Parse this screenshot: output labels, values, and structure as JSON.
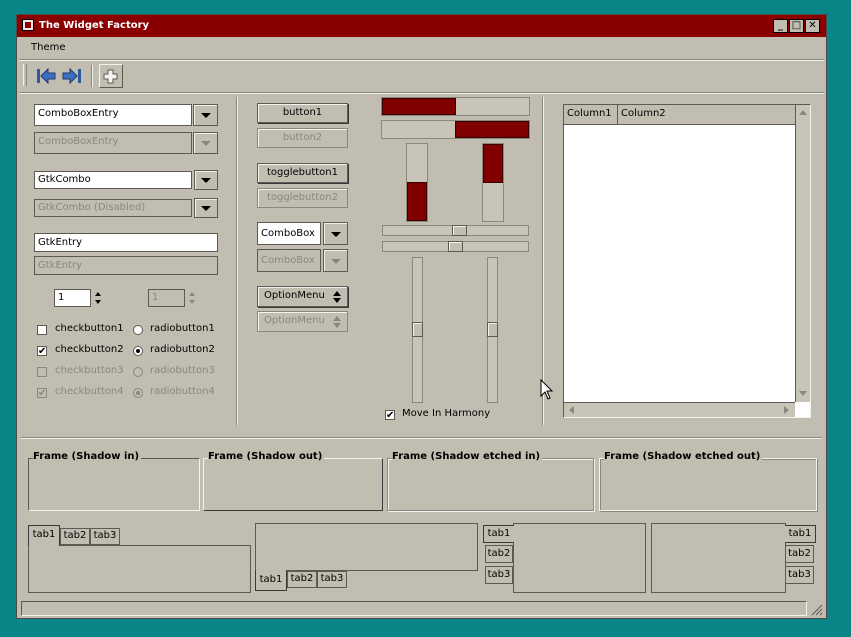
{
  "window": {
    "title": "The Widget Factory",
    "buttons": {
      "minimize": "_",
      "maximize": "□",
      "close": "✕"
    }
  },
  "menu": {
    "theme": "Theme"
  },
  "toolbar": {
    "items": [
      "back-icon",
      "forward-icon",
      "insert-icon"
    ]
  },
  "left": {
    "combo_entry": "ComboBoxEntry",
    "combo_entry_disabled": "ComboBoxEntry",
    "gtk_combo": "GtkCombo",
    "gtk_combo_disabled": "GtkCombo (Disabled)",
    "entry": "GtkEntry",
    "entry_disabled": "GtkEntry",
    "spin": "1",
    "spin_disabled": "1",
    "check1": "checkbutton1",
    "check2": "checkbutton2",
    "check3": "checkbutton3",
    "check4": "checkbutton4",
    "radio1": "radiobutton1",
    "radio2": "radiobutton2",
    "radio3": "radiobutton3",
    "radio4": "radiobutton4",
    "check_mark": "✔"
  },
  "middle": {
    "button1": "button1",
    "button2": "button2",
    "toggle1": "togglebutton1",
    "toggle2": "togglebutton2",
    "combobox": "ComboBox",
    "combobox_disabled": "ComboBox",
    "option_menu": "OptionMenu",
    "option_menu_disabled": "OptionMenu"
  },
  "sliders": {
    "progress_h1": 0.5,
    "progress_h2": 0.5,
    "progress_v1": 0.5,
    "progress_v2": 0.5,
    "harmony_label": "Move In Harmony",
    "harmony_checked": true
  },
  "tree": {
    "columns": [
      "Column1",
      "Column2"
    ]
  },
  "frames": [
    "Frame (Shadow in)",
    "Frame (Shadow out)",
    "Frame (Shadow etched in)",
    "Frame (Shadow etched out)"
  ],
  "notebooks": {
    "tabs": [
      "tab1",
      "tab2",
      "tab3"
    ]
  },
  "colors": {
    "accent": "#800000",
    "titlebar": "#8a0000",
    "background": "#c2bdb1",
    "desktop": "#0a8587"
  }
}
